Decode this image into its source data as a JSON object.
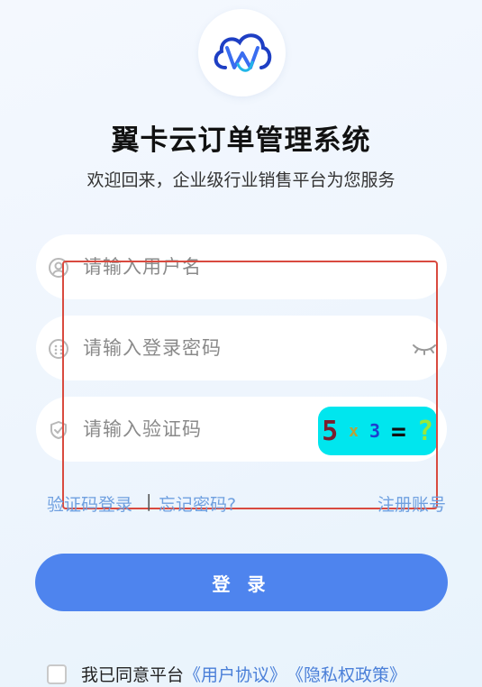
{
  "app": {
    "title": "翼卡云订单管理系统",
    "subtitle": "欢迎回来，企业级行业销售平台为您服务",
    "logo_icon": "cloud-w-logo-icon"
  },
  "form": {
    "username_placeholder": "请输入用户名",
    "password_placeholder": "请输入登录密码",
    "captcha_placeholder": "请输入验证码",
    "captcha": {
      "chars": [
        "5",
        "x",
        "3",
        "=",
        "?"
      ],
      "background": "#00e6ee"
    }
  },
  "links": {
    "sms_login": "验证码登录",
    "separator": "|",
    "forgot_password": "忘记密码?",
    "register": "注册账号"
  },
  "login_button": "登 录",
  "agreement": {
    "prefix": "我已同意平台",
    "user_agreement": "《用户协议》",
    "privacy_policy": "《隐私权政策》"
  },
  "colors": {
    "primary": "#4e84ee",
    "link": "#6fa0e0",
    "highlight_box": "#d94a3f"
  }
}
